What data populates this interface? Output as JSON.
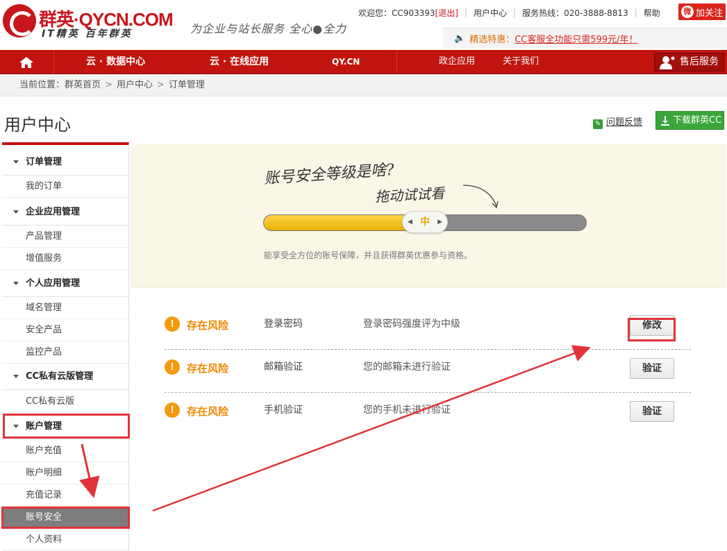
{
  "header": {
    "logo_brand": "群英·QYCN.COM",
    "logo_sub": "IT精英 百年群英",
    "slogan": "为企业与站长服务 全心●全力",
    "welcome": "欢迎您：CC903393",
    "logout": "[退出]",
    "user_center": "用户中心",
    "hotline": "服务热线：020-3888-8813",
    "help": "帮助",
    "follow": "加关注",
    "follow_icon": "weibo-icon",
    "notice_label": "精选特惠：",
    "notice_text": "CC客服全功能只需599元/年！"
  },
  "nav": {
    "home_icon": "home-icon",
    "items": [
      "云 · 数据中心",
      "云 · 在线应用",
      "QY.CN",
      "政企应用",
      "关于我们"
    ],
    "service": "售后服务"
  },
  "breadcrumb": {
    "prefix": "当前位置：",
    "items": [
      "群英首页",
      "用户中心",
      "订单管理"
    ],
    "separator": ">"
  },
  "page": {
    "title": "用户中心",
    "feedback": "问题反馈",
    "download": "下载群英CC"
  },
  "sidebar": {
    "groups": [
      {
        "title": "订单管理",
        "items": [
          "我的订单"
        ]
      },
      {
        "title": "企业应用管理",
        "items": [
          "产品管理",
          "增值服务"
        ]
      },
      {
        "title": "个人应用管理",
        "items": [
          "域名管理",
          "安全产品",
          "监控产品"
        ]
      },
      {
        "title": "CC私有云版管理",
        "items": [
          "CC私有云版"
        ]
      },
      {
        "title": "账户管理",
        "items": [
          "账户充值",
          "账户明细",
          "充值记录",
          "账号安全",
          "个人资料"
        ]
      }
    ],
    "active_item": "账号安全"
  },
  "security": {
    "handwriting_line1": "账号安全等级是啥?",
    "handwriting_line2": "拖动试试看",
    "level_label": "中",
    "level_fraction": 0.5,
    "note": "能享受全方位的账号保障，并且获得群英优惠参与资格。",
    "rows": [
      {
        "status": "存在风险",
        "item": "登录密码",
        "desc": "登录密码强度评为中级",
        "button": "修改"
      },
      {
        "status": "存在风险",
        "item": "邮箱验证",
        "desc": "您的邮箱未进行验证",
        "button": "验证"
      },
      {
        "status": "存在风险",
        "item": "手机验证",
        "desc": "您的手机未进行验证",
        "button": "验证"
      }
    ]
  },
  "colors": {
    "brand_red": "#c1140f",
    "highlight_red": "#e03238",
    "warning_orange": "#f08a00",
    "slider_yellow": "#f2c318",
    "active_gray": "#7d7d7d"
  }
}
